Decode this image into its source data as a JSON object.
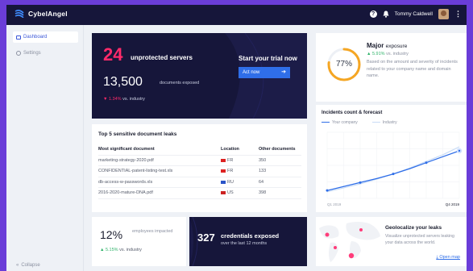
{
  "app": {
    "name": "CybelAngel"
  },
  "header": {
    "user_name": "Tommy Caldwell",
    "help_icon": "question-icon",
    "bell_icon": "bell-icon"
  },
  "sidebar": {
    "items": [
      {
        "label": "Dashboard",
        "icon": "dashboard-icon",
        "active": true
      },
      {
        "label": "Settings",
        "icon": "gear-icon",
        "active": false
      }
    ],
    "collapse_label": "Collapse"
  },
  "hero": {
    "servers_count": "24",
    "servers_label": "unprotected servers",
    "documents_count": "13,500",
    "documents_label": "documents exposed",
    "trend_value": "▼ 1.34%",
    "trend_label": "vs. industry",
    "trial_title": "Start your trial now",
    "cta_label": "Act now",
    "cta_arrow": "➔"
  },
  "exposure": {
    "gauge_value": "77%",
    "gauge_fraction": 0.77,
    "title": "Major",
    "title_sub": "exposure",
    "trend_value": "▲ 5.91%",
    "trend_label": "vs. industry",
    "description": "Based on the amount and severity of incidents related to your company name and domain name."
  },
  "leaks": {
    "title": "Top 5 sensitive document leaks",
    "columns": [
      "Most significant document",
      "Location",
      "Other documents"
    ],
    "rows": [
      {
        "document": "marketing-strategy-2020.pdf",
        "location": "FR",
        "count": "350",
        "flag_color": "#d22"
      },
      {
        "document": "CONFIDENTIAL-patent-listing-test.xls",
        "location": "FR",
        "count": "133",
        "flag_color": "#d22"
      },
      {
        "document": "db-access-w-passwords.xls",
        "location": "RU",
        "count": "64",
        "flag_color": "#2a54c8"
      },
      {
        "document": "2016-2020-mature-DNA.pdf",
        "location": "US",
        "count": "398",
        "flag_color": "#c22"
      }
    ]
  },
  "chart_data": {
    "type": "line",
    "title": "Incidents count & forecast",
    "series": [
      {
        "name": "Your company",
        "color": "#2f6ee8",
        "values": [
          0.12,
          0.18,
          0.24,
          0.3,
          0.37,
          0.45,
          0.54,
          0.63,
          0.72
        ]
      },
      {
        "name": "Industry",
        "color": "#c9dcf6",
        "values": [
          0.1,
          0.16,
          0.22,
          0.29,
          0.37,
          0.46,
          0.56,
          0.66,
          0.78
        ]
      }
    ],
    "x_tick_labels": [
      "Q1 2019",
      "",
      "",
      "",
      "",
      "",
      "",
      "",
      "Q4 2019"
    ],
    "grid": true,
    "legend": "top-left"
  },
  "stat_employees": {
    "value": "12%",
    "label": "employees impacted",
    "trend_value": "▲ 5.15%",
    "trend_label": "vs. industry"
  },
  "stat_credentials": {
    "value": "327",
    "label": "credentials exposed",
    "sub": "over the last 12 months"
  },
  "geo": {
    "title": "Geolocalize your leaks",
    "description": "Visualize unprotected servers leaking your data across the world.",
    "link_label": "Open map"
  },
  "colors": {
    "accent": "#2f6ee8",
    "danger": "#ff2a6a",
    "success": "#2fb36a",
    "dark": "#16163a",
    "brand_bg": "#6a3dd8"
  }
}
